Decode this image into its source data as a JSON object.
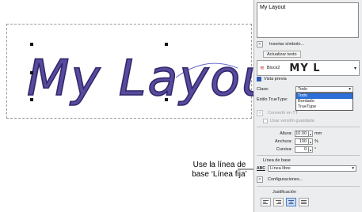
{
  "canvas": {
    "layout_text": "My Layout",
    "callout_line1": "Use la línea de",
    "callout_line2": "base ‘Línea fija’"
  },
  "panel": {
    "textbox_value": "My Layout",
    "insert_symbols": "Insertar símbolo...",
    "update_text": "Actualizar texto",
    "font_name": "Block2",
    "font_preview": "MY L",
    "preview_label": "Vista previa",
    "class_label": "Clase:",
    "class_value": "Todo",
    "class_options": [
      "Todo",
      "Bordado",
      "TrueType"
    ],
    "truetype_style_label": "Estilo TrueType:",
    "convert_label": "Convertir en TT",
    "save_converted_label": "Usar versión guardada",
    "height_label": "Altura:",
    "height_value": "10.00",
    "height_unit": "mm",
    "width_label": "Anchura:",
    "width_value": "100",
    "width_unit": "%",
    "italic_label": "Cursiva:",
    "italic_value": "0",
    "italic_unit": "°",
    "baseline_label": "Línea de base",
    "baseline_icon": "ABC",
    "baseline_value": "Línea libre",
    "settings_label": "Configuraciones...",
    "justification_label": "Justificación"
  },
  "colors": {
    "stitch_fill": "#5a4a9e",
    "stitch_outline": "#2e2a6b",
    "accent": "#2c6fd6"
  }
}
